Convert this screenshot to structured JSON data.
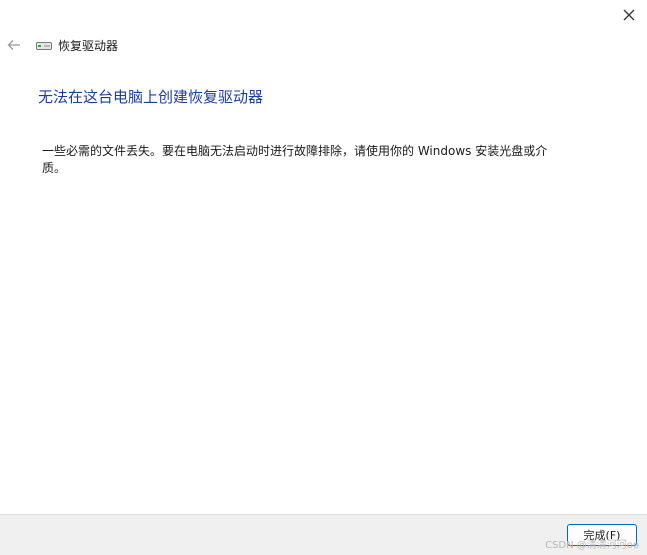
{
  "window": {
    "title": "恢复驱动器"
  },
  "content": {
    "heading": "无法在这台电脑上创建恢复驱动器",
    "message": "一些必需的文件丢失。要在电脑无法启动时进行故障排除，请使用你的 Windows 安装光盘或介质。"
  },
  "footer": {
    "finish_label": "完成(F)"
  },
  "watermark": {
    "text": "CSDN @清清河河oo"
  },
  "icons": {
    "close": "close-icon",
    "back": "back-arrow-icon",
    "drive": "drive-icon"
  },
  "colors": {
    "heading": "#1c3f94",
    "accent": "#0067c0",
    "footer_bg": "#f0f0f0"
  }
}
